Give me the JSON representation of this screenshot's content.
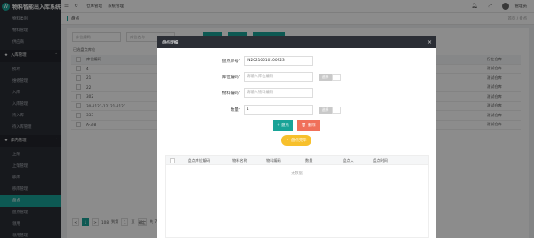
{
  "app": {
    "title": "物料智能出入库系统",
    "logo_char": "W"
  },
  "sidebar": {
    "top_items": [
      "物料类别",
      "物料管理",
      "供应商"
    ],
    "groups": [
      {
        "label": "入库管理",
        "items": [
          "损坏",
          "维修管理",
          "入库",
          "入库管理",
          "待入库",
          "待入库管理"
        ]
      },
      {
        "label": "库内管理",
        "items": [
          "上架",
          "上架管理",
          "移库",
          "移库管理",
          "盘点",
          "盘点管理",
          "领用",
          "领用管理"
        ]
      }
    ],
    "active_item": "盘点"
  },
  "topbar": {
    "menu": [
      "仓库管理",
      "系统管理"
    ],
    "user": "管理员"
  },
  "tabbar": {
    "tab": "盘点",
    "breadcrumb": "首页 / 盘点"
  },
  "page": {
    "filters": [
      "库位编码",
      "库位名称"
    ],
    "selected_hint": "已选盘点库位",
    "table": {
      "header": {
        "name": "库位编码",
        "warehouse": "所在仓库"
      },
      "rows": [
        {
          "name": "4",
          "warehouse": "测试仓库"
        },
        {
          "name": "21",
          "warehouse": "测试仓库"
        },
        {
          "name": "22",
          "warehouse": "测试仓库"
        },
        {
          "name": "302",
          "warehouse": "测试仓库"
        },
        {
          "name": "30-2121-12121-2121",
          "warehouse": "测试仓库"
        },
        {
          "name": "333",
          "warehouse": "测试仓库"
        },
        {
          "name": "A-3-8",
          "warehouse": "测试仓库"
        }
      ]
    },
    "pager": {
      "prev": "<",
      "current": "1",
      "next": ">",
      "total_pages": "108",
      "jump_label": "到第",
      "jump_value": "1",
      "page_unit": "页",
      "go": "确定",
      "total": "共 7 条"
    }
  },
  "modal": {
    "title": "盘点明细",
    "close": "×",
    "fields": {
      "order_no": {
        "label": "盘点单号*",
        "value": "IN20210510100923"
      },
      "location": {
        "label": "库位编码*",
        "placeholder": "请输入库位编码",
        "button": "选择"
      },
      "material": {
        "label": "物料编码*",
        "placeholder": "请输入物料编码"
      },
      "quantity": {
        "label": "数量*",
        "value": "1",
        "button": "选择"
      }
    },
    "actions": {
      "add": "+ 盘点",
      "delete": "删除",
      "done": "盘点完毕"
    },
    "table": {
      "columns": [
        "盘点库位编码",
        "物料名称",
        "物料编码",
        "数量",
        "盘点人",
        "盘点时间"
      ],
      "empty": "无数据"
    }
  },
  "colors": {
    "accent": "#19a397",
    "sidebar": "#2b2e35",
    "danger": "#f0705a",
    "warning": "#f7c02c"
  }
}
